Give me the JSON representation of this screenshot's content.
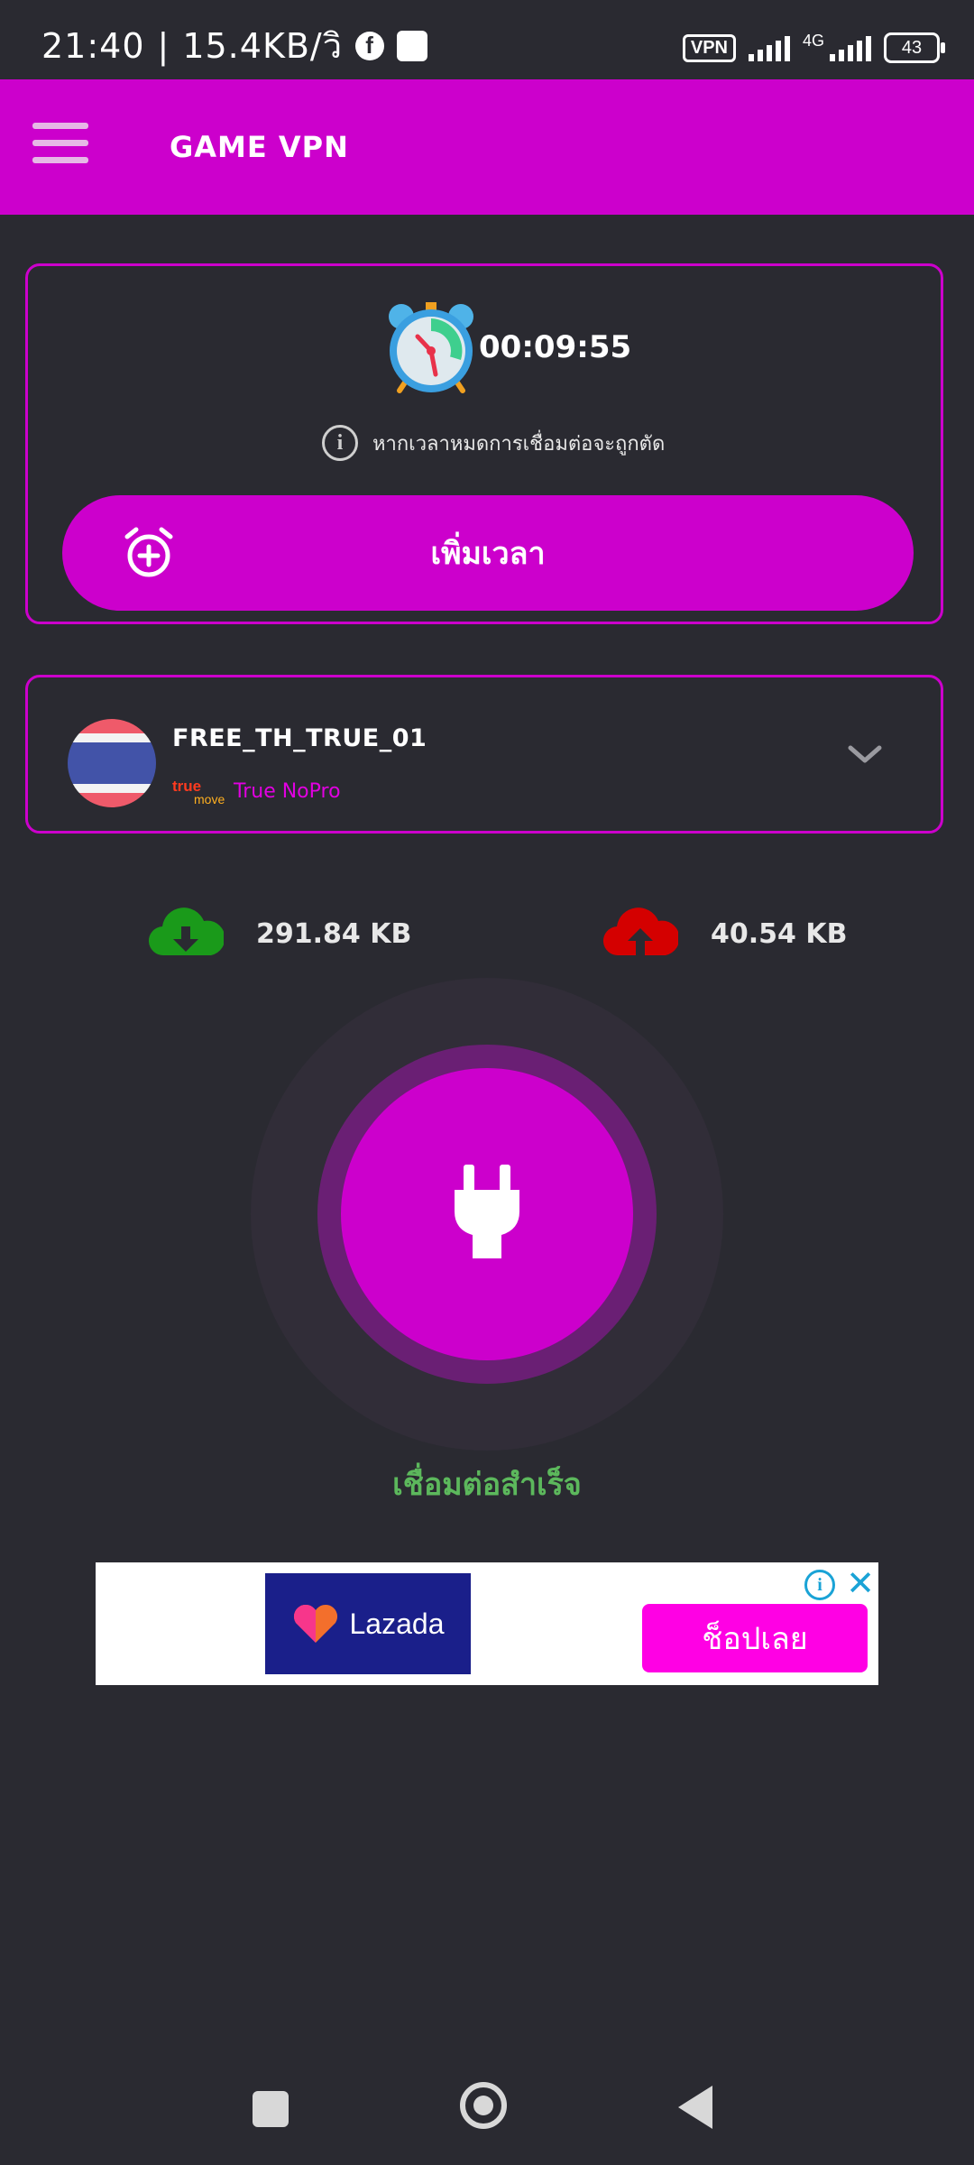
{
  "status_bar": {
    "time": "21:40",
    "separator": "|",
    "speed": "15.4KB/วิ",
    "fb_icon": "f",
    "vpn_label": "VPN",
    "network": "4G",
    "battery": "43"
  },
  "app_bar": {
    "title": "GAME VPN",
    "menu_icon": "hamburger-icon"
  },
  "timer": {
    "value": "00:09:55",
    "info_text": "หากเวลาหมดการเชื่อมต่อจะถูกตัด",
    "info_icon_glyph": "i",
    "add_time_label": "เพิ่มเวลา"
  },
  "server": {
    "name": "FREE_TH_TRUE_01",
    "carrier_logo_top": "true",
    "carrier_logo_bottom": "move",
    "provider": "True NoPro",
    "flag": "thailand-flag-icon"
  },
  "traffic": {
    "download": "291.84 KB",
    "upload": "40.54 KB"
  },
  "connect": {
    "status": "เชื่อมต่อสำเร็จ"
  },
  "ad": {
    "brand": "Lazada",
    "cta": "ช็อปเลย",
    "info_glyph": "i",
    "close_glyph": "✕"
  },
  "colors": {
    "accent": "#cc00cc",
    "background": "#2a2a31",
    "success": "#5cb85c",
    "download": "#1a9a1a",
    "upload": "#d40000"
  }
}
